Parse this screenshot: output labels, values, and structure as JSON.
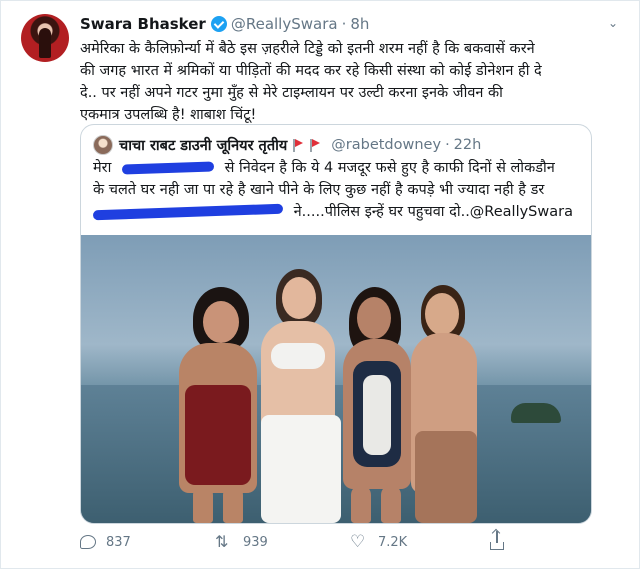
{
  "tweet": {
    "author_name": "Swara Bhasker",
    "handle": "@ReallySwara",
    "separator": "·",
    "time": "8h",
    "text_lines": [
      "अमेरिका के कैलिफ़ोर्न्या में बैठे इस ज़हरीले टिड्डे को इतनी शरम नहीं है कि बकवासें करने",
      "की जगह भारत में श्रमिकों या पीड़ितों की मदद कर रहे किसी संस्था को कोई डोनेशन ही दे",
      "दे.. पर नहीं अपने गटर नुमा मुँह से मेरे टाइम्लायन पर उल्टी करना इनके जीवन की",
      "एकमात्र उपलब्धि है! शाबाश चिंटू!"
    ]
  },
  "quoted": {
    "author_name": "चाचा राबट डाउनी जूनियर तृतीय",
    "handle": "@rabetdowney",
    "separator": "·",
    "time": "22h",
    "line1_prefix": "मेरा",
    "line1_suffix": "से निवेदन है कि ये 4 मजदूर फसे हुए है काफी दिनों से लोकडौन",
    "line2": "के चलते घर नही जा पा रहे है खाने पीने के लिए कुछ नहीं है कपड़े भी ज्यादा नही है डर",
    "line3_suffix": "ने.....पीलिस इन्हें घर पहुचवा दो..@ReallySwara"
  },
  "actions": {
    "replies": "837",
    "retweets": "939",
    "likes": "7.2K"
  },
  "icons": [
    "verified-badge-icon",
    "caret-down-icon",
    "flag-icon",
    "reply-icon",
    "retweet-icon",
    "like-icon",
    "share-icon"
  ],
  "colors": {
    "accent": "#1da1f2",
    "muted": "#657786",
    "border": "#ccd6dd",
    "scribble": "#1f3fe0"
  }
}
